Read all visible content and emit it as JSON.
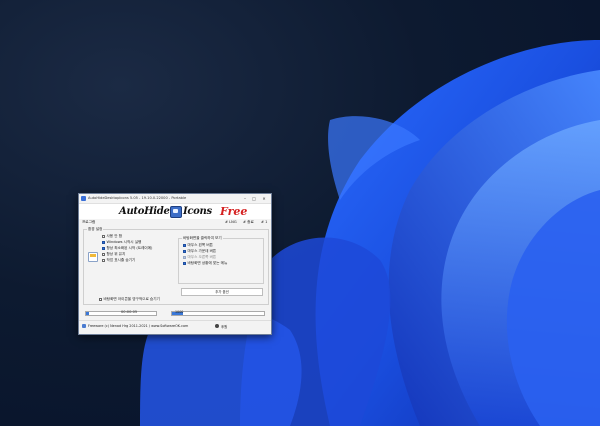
{
  "window": {
    "title": "AutoHideDesktopIcons 5.05 - 19.10.0.22000 - Portable"
  },
  "banner": {
    "logo_auto": "AutoHide",
    "logo_icons": "Icons",
    "logo_free": "Free"
  },
  "menu": {
    "left": "프로그램",
    "links": [
      "# LNG",
      "# 종료",
      "# 1"
    ]
  },
  "settings": {
    "group_title": "환경 설정",
    "items": [
      {
        "label": "사용 안 함",
        "checked": false
      },
      {
        "label": "Windows 시작시 실행",
        "checked": true
      },
      {
        "label": "항상 최소화된 시작 (트레이에)",
        "checked": true
      },
      {
        "label": "항상 위 유지",
        "checked": false
      },
      {
        "label": "작업 표시줄 숨기기",
        "checked": false
      }
    ],
    "subgroup_title": "바탕화면을 클릭하여 보기",
    "sub_items": [
      {
        "label": "마우스 왼쪽 버튼",
        "checked": true,
        "dim": false
      },
      {
        "label": "마우스 가운데 버튼",
        "checked": true,
        "dim": false
      },
      {
        "label": "마우스 오른쪽 버튼",
        "checked": false,
        "dim": true
      },
      {
        "label": "바탕화면 상황에 맞는 메뉴",
        "checked": true,
        "dim": false
      }
    ],
    "more_button": "추가 옵션",
    "bottom_checkbox": "바탕화면 아이콘을 영구적으로 숨기기"
  },
  "progress": {
    "time": "00:00:05",
    "left_fill": 0.04,
    "right_label": "1000",
    "right_fill": 0.12
  },
  "footer": {
    "text": "Freeware (c) Nenad Hrg 2011-2021 / www.SoftwareOK.com",
    "donate": "후원"
  }
}
